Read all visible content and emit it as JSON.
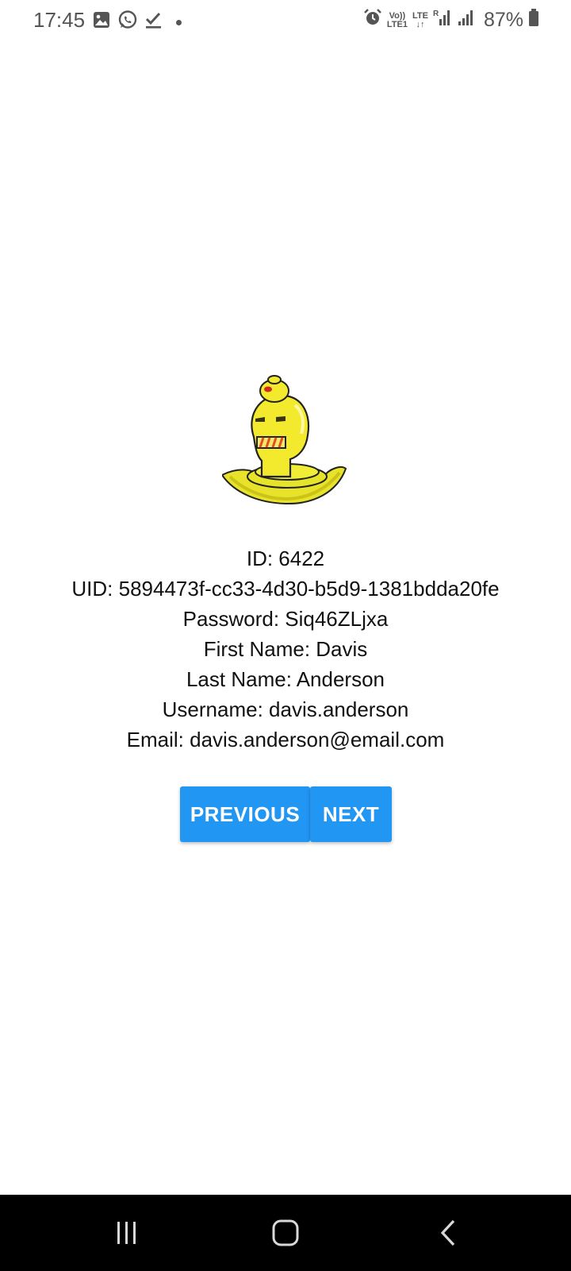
{
  "status_bar": {
    "time": "17:45",
    "battery": "87%",
    "net_volte": "Vo)) LTE1",
    "net_lte": "LTE",
    "left_icons": [
      "gallery-icon",
      "whatsapp-icon",
      "checkmark-icon",
      "dot-icon"
    ],
    "right_icons": [
      "alarm-icon",
      "volte-icon",
      "lte-icon",
      "signal-roaming-icon",
      "signal-icon",
      "battery-icon"
    ]
  },
  "profile": {
    "avatar_icon": "yellow-robot-avatar",
    "id": "ID: 6422",
    "uid": "UID: 5894473f-cc33-4d30-b5d9-1381bdda20fe",
    "password": "Password: Siq46ZLjxa",
    "first_name": "First Name: Davis",
    "last_name": "Last Name: Anderson",
    "username": "Username: davis.anderson",
    "email": "Email: davis.anderson@email.com"
  },
  "buttons": {
    "previous": "PREVIOUS",
    "next": "NEXT",
    "color": "#2196f3"
  },
  "nav_bar": {
    "items": [
      "recent-apps-icon",
      "home-icon",
      "back-icon"
    ]
  }
}
